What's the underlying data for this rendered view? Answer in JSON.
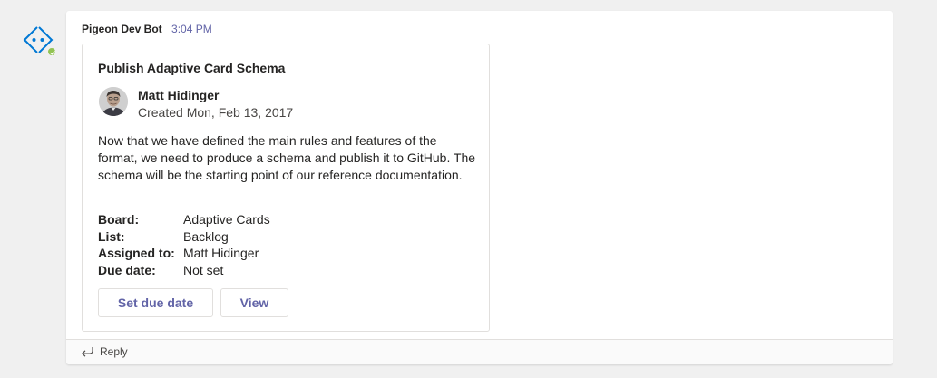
{
  "bot": {
    "avatar_icon": "code-brackets-icon",
    "presence": "available",
    "accent_color": "#0078d4",
    "presence_color": "#92c353"
  },
  "message": {
    "sender": "Pigeon Dev Bot",
    "timestamp": "3:04 PM"
  },
  "card": {
    "title": "Publish Adaptive Card Schema",
    "person": {
      "name": "Matt Hidinger",
      "created": "Created Mon, Feb 13, 2017"
    },
    "description": "Now that we have defined the main rules and features of the format, we need to produce a schema and publish it to GitHub. The schema will be the starting point of our reference documentation.",
    "facts": [
      {
        "label": "Board:",
        "value": "Adaptive Cards"
      },
      {
        "label": "List:",
        "value": "Backlog"
      },
      {
        "label": "Assigned to:",
        "value": "Matt Hidinger"
      },
      {
        "label": "Due date:",
        "value": "Not set"
      }
    ],
    "actions": {
      "set_due_date": "Set due date",
      "view": "View"
    },
    "action_color": "#6264a7"
  },
  "reply": {
    "label": "Reply",
    "icon": "reply-arrow-icon"
  }
}
